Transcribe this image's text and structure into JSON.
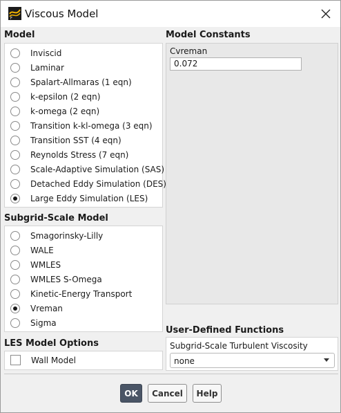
{
  "window": {
    "title": "Viscous Model"
  },
  "model": {
    "title": "Model",
    "options": [
      "Inviscid",
      "Laminar",
      "Spalart-Allmaras (1 eqn)",
      "k-epsilon (2 eqn)",
      "k-omega (2 eqn)",
      "Transition k-kl-omega (3 eqn)",
      "Transition SST (4 eqn)",
      "Reynolds Stress (7 eqn)",
      "Scale-Adaptive Simulation (SAS)",
      "Detached Eddy Simulation (DES)",
      "Large Eddy Simulation (LES)"
    ],
    "selected_index": 10
  },
  "subgrid": {
    "title": "Subgrid-Scale Model",
    "options": [
      "Smagorinsky-Lilly",
      "WALE",
      "WMLES",
      "WMLES S-Omega",
      "Kinetic-Energy Transport",
      "Vreman",
      "Sigma"
    ],
    "selected_index": 5
  },
  "les_options": {
    "title": "LES Model Options",
    "wall_model_label": "Wall Model",
    "wall_model_checked": false
  },
  "constants": {
    "title": "Model Constants",
    "items": [
      {
        "label": "Cvreman",
        "value": "0.072"
      }
    ]
  },
  "udf": {
    "title": "User-Defined Functions",
    "label": "Subgrid-Scale Turbulent Viscosity",
    "value": "none"
  },
  "buttons": {
    "ok": "OK",
    "cancel": "Cancel",
    "help": "Help"
  },
  "colors": {
    "primary_button": "#4a5566",
    "panel_bg": "#f0f0f0"
  }
}
